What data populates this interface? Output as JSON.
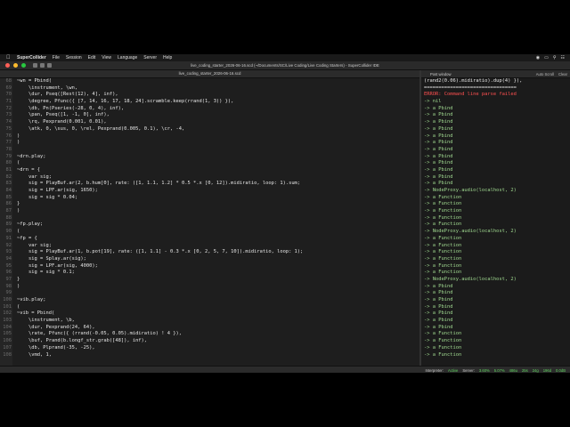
{
  "menubar": {
    "app": "SuperCollider",
    "items": [
      "File",
      "Session",
      "Edit",
      "View",
      "Language",
      "Server",
      "Help"
    ]
  },
  "window_title": "live_coding_starter_2026-06-16.scd (~/Documents/SC/Live Coding/Live Coding Starters) - SuperCollider IDE",
  "editor_tab": "live_coding_starter_2026-06-16.scd",
  "code_lines": [
    {
      "n": "68",
      "t": "~wn = Pbind("
    },
    {
      "n": "69",
      "t": "    \\instrument, \\wn,"
    },
    {
      "n": "70",
      "t": "    \\dur, Pseq([Rest(12), 4], inf),"
    },
    {
      "n": "71",
      "t": "    \\degree, Pfunc({ [7, 14, 16, 17, 18, 24].scramble.keep(rrand(1, 3)) }),"
    },
    {
      "n": "72",
      "t": "    \\db, Pn(Pseries(-28, 0, 4), inf),"
    },
    {
      "n": "73",
      "t": "    \\pan, Pseq([1, -1, 0], inf),"
    },
    {
      "n": "74",
      "t": "    \\rq, Pexprand(0.001, 0.01),"
    },
    {
      "n": "75",
      "t": "    \\atk, 0, \\sus, 0, \\rel, Pexprand(0.005, 0.1), \\cr, -4,"
    },
    {
      "n": "76",
      "t": ")"
    },
    {
      "n": "77",
      "t": ")"
    },
    {
      "n": "78",
      "t": ""
    },
    {
      "n": "79",
      "t": "~drn.play;"
    },
    {
      "n": "80",
      "t": "("
    },
    {
      "n": "81",
      "t": "~drn = {"
    },
    {
      "n": "82",
      "t": "    var sig;"
    },
    {
      "n": "83",
      "t": "    sig = PlayBuf.ar(2, b.hum[0], rate: ([1, 1.1, 1.2] * 0.5 *.x [0, 12]).midiratio, loop: 1).sum;"
    },
    {
      "n": "84",
      "t": "    sig = LPF.ar(sig, 1650);"
    },
    {
      "n": "85",
      "t": "    sig = sig * 0.04;"
    },
    {
      "n": "86",
      "t": "}"
    },
    {
      "n": "87",
      "t": ")"
    },
    {
      "n": "88",
      "t": ""
    },
    {
      "n": "89",
      "t": "~fp.play;"
    },
    {
      "n": "90",
      "t": "("
    },
    {
      "n": "91",
      "t": "~fp = {"
    },
    {
      "n": "92",
      "t": "    var sig;"
    },
    {
      "n": "93",
      "t": "    sig = PlayBuf.ar(1, b.pot[19], rate: ([1, 1.1] - 0.3 *.x [0, 2, 5, 7, 10]).midiratio, loop: 1);"
    },
    {
      "n": "94",
      "t": "    sig = Splay.ar(sig);"
    },
    {
      "n": "95",
      "t": "    sig = LPF.ar(sig, 4000);"
    },
    {
      "n": "96",
      "t": "    sig = sig * 0.1;"
    },
    {
      "n": "97",
      "t": "}"
    },
    {
      "n": "98",
      "t": ")"
    },
    {
      "n": "99",
      "t": ""
    },
    {
      "n": "100",
      "t": "~vib.play;"
    },
    {
      "n": "101",
      "t": "("
    },
    {
      "n": "102",
      "t": "~vib = Pbind("
    },
    {
      "n": "103",
      "t": "    \\instrument, \\b,"
    },
    {
      "n": "104",
      "t": "    \\dur, Pexprand(24, 64),"
    },
    {
      "n": "105",
      "t": "    \\rate, Pfunc({ (rrand(-0.05, 0.05).midiratio) ! 4 }),"
    },
    {
      "n": "106",
      "t": "    \\buf, Prand(b.longf_str.grab([48]), inf),"
    },
    {
      "n": "107",
      "t": "    \\db, Plprand(-35, -25),"
    },
    {
      "n": "108",
      "t": "    \\vmd, 1,"
    }
  ],
  "post_window": {
    "title": "Post window",
    "buttons": [
      "Auto Scroll",
      "Clear"
    ],
    "lines": [
      {
        "t": "(rand2(0.06).midiratio).dup(4) }),",
        "k": "plain"
      },
      {
        "t": "================================",
        "k": "plain"
      },
      {
        "t": "ERROR: Command line parse failed",
        "k": "err"
      },
      {
        "t": "-> nil",
        "k": "ok"
      },
      {
        "t": "-> a Pbind",
        "k": "ok"
      },
      {
        "t": "-> a Pbind",
        "k": "ok"
      },
      {
        "t": "-> a Pbind",
        "k": "ok"
      },
      {
        "t": "-> a Pbind",
        "k": "ok"
      },
      {
        "t": "-> a Pbind",
        "k": "ok"
      },
      {
        "t": "-> a Pbind",
        "k": "ok"
      },
      {
        "t": "-> a Pbind",
        "k": "ok"
      },
      {
        "t": "-> a Pbind",
        "k": "ok"
      },
      {
        "t": "-> a Pbind",
        "k": "ok"
      },
      {
        "t": "-> a Pbind",
        "k": "ok"
      },
      {
        "t": "-> a Pbind",
        "k": "ok"
      },
      {
        "t": "-> a Pbind",
        "k": "ok"
      },
      {
        "t": "-> NodeProxy.audio(localhost, 2)",
        "k": "ok"
      },
      {
        "t": "-> a Function",
        "k": "ok"
      },
      {
        "t": "-> a Function",
        "k": "ok"
      },
      {
        "t": "-> a Function",
        "k": "ok"
      },
      {
        "t": "-> a Function",
        "k": "ok"
      },
      {
        "t": "-> a Function",
        "k": "ok"
      },
      {
        "t": "-> NodeProxy.audio(localhost, 2)",
        "k": "ok"
      },
      {
        "t": "-> a Function",
        "k": "ok"
      },
      {
        "t": "-> a Function",
        "k": "ok"
      },
      {
        "t": "-> a Function",
        "k": "ok"
      },
      {
        "t": "-> a Function",
        "k": "ok"
      },
      {
        "t": "-> a Function",
        "k": "ok"
      },
      {
        "t": "-> a Function",
        "k": "ok"
      },
      {
        "t": "-> NodeProxy.audio(localhost, 2)",
        "k": "ok"
      },
      {
        "t": "-> a Pbind",
        "k": "ok"
      },
      {
        "t": "-> a Pbind",
        "k": "ok"
      },
      {
        "t": "-> a Pbind",
        "k": "ok"
      },
      {
        "t": "-> a Pbind",
        "k": "ok"
      },
      {
        "t": "-> a Pbind",
        "k": "ok"
      },
      {
        "t": "-> a Pbind",
        "k": "ok"
      },
      {
        "t": "-> a Pbind",
        "k": "ok"
      },
      {
        "t": "-> a Function",
        "k": "ok"
      },
      {
        "t": "-> a Function",
        "k": "ok"
      },
      {
        "t": "-> a Function",
        "k": "ok"
      },
      {
        "t": "-> a Function",
        "k": "ok"
      }
    ]
  },
  "status_bar": {
    "interpreter_label": "Interpreter:",
    "interpreter_state": "Active",
    "server_label": "Server:",
    "cpu_avg": "3.60%",
    "cpu_peak": "5.07%",
    "ugens": "486u",
    "synths": "25s",
    "groups": "24g",
    "synthdefs": "196d",
    "volume": "0.0dB",
    "state_color": "#5fd35f",
    "error_color": "#ff5050",
    "post_text_color": "#9fd88f"
  }
}
